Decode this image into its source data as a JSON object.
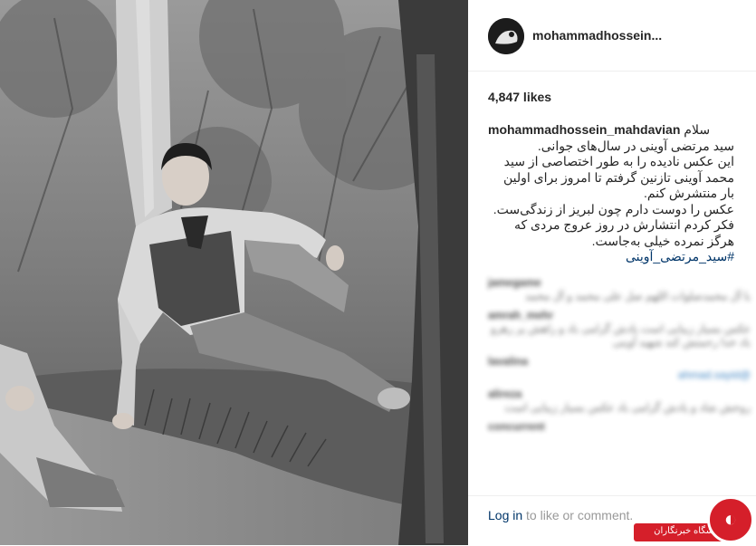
{
  "post": {
    "username_short": "mohammadhossein...",
    "likes": "4,847 likes",
    "caption": {
      "username": "mohammadhossein_mahdavian",
      "greeting": "سلام",
      "lines": [
        "سید مرتضی آوینی در سال‌های جوانی.",
        "این عکس نادیده را به طور اختصاصی از سید محمد آوینی تازنین گرفتم تا امروز برای اولین بار منتشرش کنم.",
        "عکس را دوست دارم چون لبریز از زندگی‌ست. فکر کردم انتشارش در روز عروج مردی که هرگز نمرده خیلی به‌جاست."
      ],
      "hashtag": "#سید_مرتضی_آوینی"
    },
    "comments": [
      {
        "user": "jamegame",
        "text": "با آل محمدصلوات اللهم صل علی محمد و آل محمد"
      },
      {
        "user": "amrah_mehr",
        "text": "عکس بسیار زیبایی است یادش گرامی باد و راهش پر رهرو باد خدا رحمتش کند شهید آوینی"
      },
      {
        "user": "lavalina",
        "text": "@ahmad.sayid"
      },
      {
        "user": "alireza",
        "text": "روحش شاد و یادش گرامی باد عکس بسیار زیبایی است"
      },
      {
        "user": "concurrent",
        "text": ""
      }
    ],
    "footer": {
      "login": "Log in",
      "rest": " to like or comment."
    }
  },
  "watermark": {
    "label": "باشگاه خبرنگاران"
  }
}
